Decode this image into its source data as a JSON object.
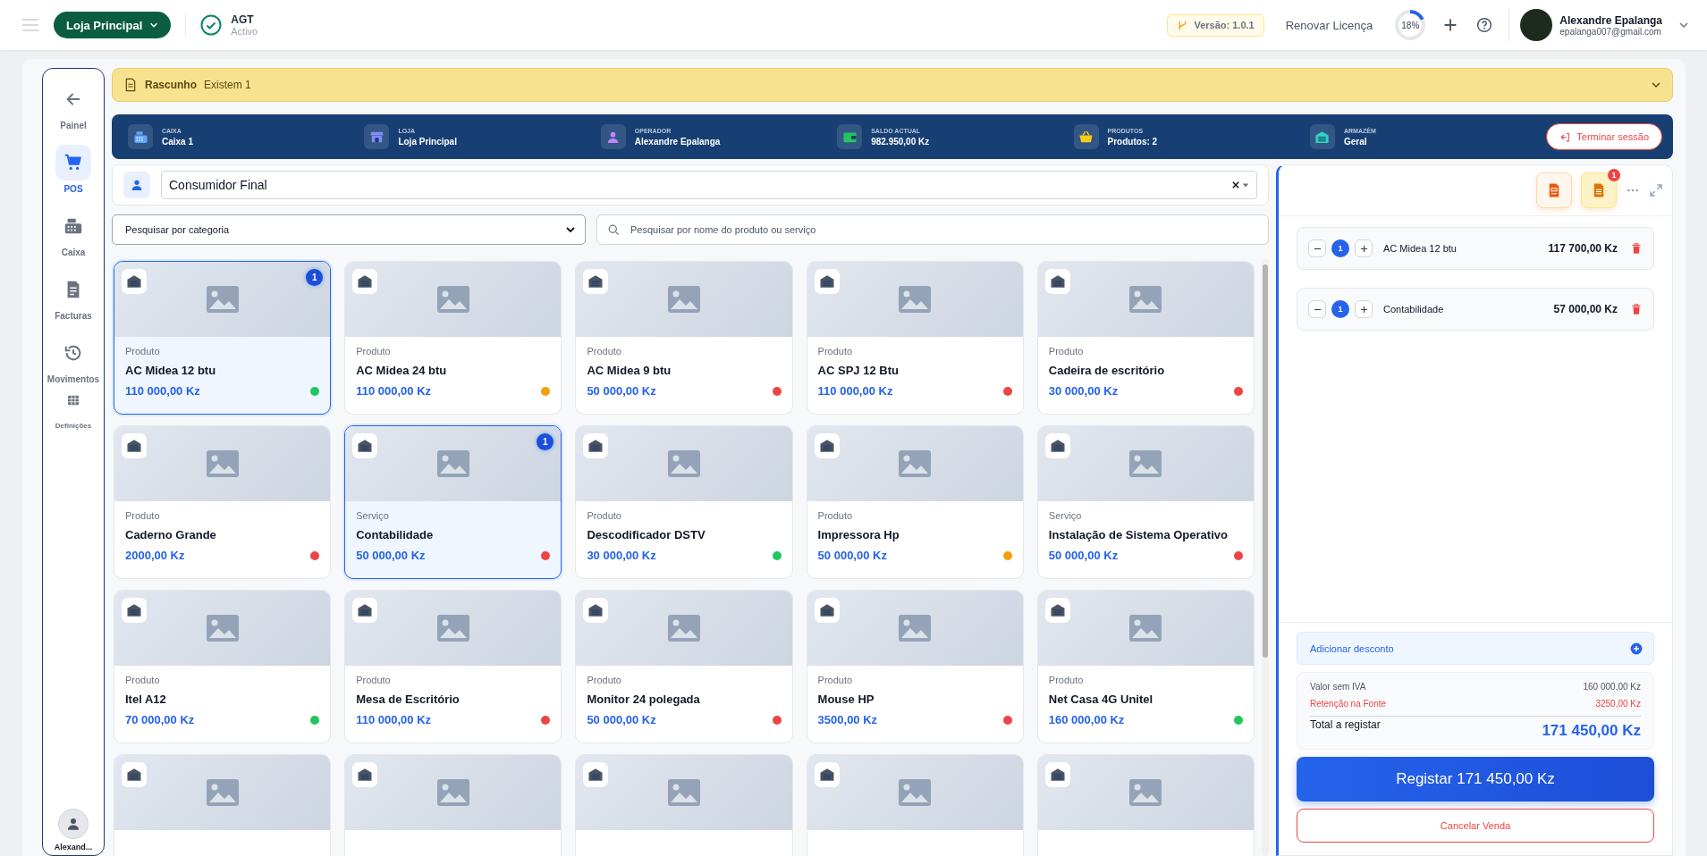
{
  "topbar": {
    "store_button": "Loja Principal",
    "agt": {
      "title": "AGT",
      "status": "Activo"
    },
    "version": "Versão: 1.0.1",
    "renew": "Renovar Licença",
    "progress": {
      "label": "18%",
      "level": 0.18
    },
    "user": {
      "name": "Alexandre Epalanga",
      "email": "epalanga007@gmail.com"
    }
  },
  "sidebar": {
    "items": [
      {
        "label": "Painel",
        "kind": "back",
        "selected": false
      },
      {
        "label": "POS",
        "kind": "cart",
        "selected": true
      },
      {
        "label": "Caixa",
        "kind": "register",
        "selected": false
      },
      {
        "label": "Facturas",
        "kind": "invoice",
        "selected": false
      },
      {
        "label": "Movimentos",
        "kind": "history",
        "selected": false
      },
      {
        "label": "Definições",
        "kind": "grid",
        "selected": false
      }
    ],
    "user_label": "Alexand..."
  },
  "draft": {
    "title": "Rascunho",
    "text": "Existem 1"
  },
  "session": {
    "items": [
      {
        "label": "CAIXA",
        "value": "Caixa 1",
        "kind": "register",
        "color": "#60a5fa"
      },
      {
        "label": "LOJA",
        "value": "Loja Principal",
        "kind": "store",
        "color": "#818cf8"
      },
      {
        "label": "OPERADOR",
        "value": "Alexandre Epalanga",
        "kind": "person",
        "color": "#c084fc"
      },
      {
        "label": "SALDO ACTUAL",
        "value": "982.950,00 Kz",
        "kind": "wallet",
        "color": "#22c55e"
      },
      {
        "label": "PRODUTOS",
        "value": "Produtos: 2",
        "kind": "basket",
        "color": "#facc15"
      },
      {
        "label": "ARMAZÉM",
        "value": "Geral",
        "kind": "warehouse",
        "color": "#2dd4bf"
      }
    ],
    "end_button": "Terminar sessão"
  },
  "customer": {
    "value": "Consumidor Final"
  },
  "category": {
    "placeholder": "Pesquisar por categoria"
  },
  "search": {
    "placeholder": "Pesquisar por nome do produto ou serviço"
  },
  "products": [
    {
      "kind": "item",
      "type": "Produto",
      "name": "AC Midea 12 btu",
      "price": "110 000,00 Kz",
      "color": "#22c55e",
      "selected": true,
      "count": "1"
    },
    {
      "kind": "item",
      "type": "Produto",
      "name": "AC Midea 24 btu",
      "price": "110 000,00 Kz",
      "color": "#f59e0b",
      "selected": false
    },
    {
      "kind": "item",
      "type": "Produto",
      "name": "AC Midea 9 btu",
      "price": "50 000,00 Kz",
      "color": "#ef4444",
      "selected": false
    },
    {
      "kind": "item",
      "type": "Produto",
      "name": "AC SPJ 12 Btu",
      "price": "110 000,00 Kz",
      "color": "#ef4444",
      "selected": false
    },
    {
      "kind": "item",
      "type": "Produto",
      "name": "Cadeira de escritório",
      "price": "30 000,00 Kz",
      "color": "#ef4444",
      "selected": false
    },
    {
      "kind": "item",
      "type": "Produto",
      "name": "Caderno Grande",
      "price": "2000,00 Kz",
      "color": "#ef4444",
      "selected": false
    },
    {
      "kind": "item",
      "type": "Serviço",
      "name": "Contabilidade",
      "price": "50 000,00 Kz",
      "color": "#ef4444",
      "selected": true,
      "count": "1"
    },
    {
      "kind": "item",
      "type": "Produto",
      "name": "Descodificador DSTV",
      "price": "30 000,00 Kz",
      "color": "#22c55e",
      "selected": false
    },
    {
      "kind": "item",
      "type": "Produto",
      "name": "Impressora Hp",
      "price": "50 000,00 Kz",
      "color": "#f59e0b",
      "selected": false
    },
    {
      "kind": "item",
      "type": "Serviço",
      "name": "Instalação de Sistema Operativo",
      "price": "50 000,00 Kz",
      "color": "#ef4444",
      "selected": false
    },
    {
      "kind": "item",
      "type": "Produto",
      "name": "Itel A12",
      "price": "70 000,00 Kz",
      "color": "#22c55e",
      "selected": false
    },
    {
      "kind": "item",
      "type": "Produto",
      "name": "Mesa de Escritório",
      "price": "110 000,00 Kz",
      "color": "#ef4444",
      "selected": false
    },
    {
      "kind": "item",
      "type": "Produto",
      "name": "Monitor 24 polegada",
      "price": "50 000,00 Kz",
      "color": "#ef4444",
      "selected": false
    },
    {
      "kind": "item",
      "type": "Produto",
      "name": "Mouse HP",
      "price": "3500,00 Kz",
      "color": "#ef4444",
      "selected": false
    },
    {
      "kind": "item",
      "type": "Produto",
      "name": "Net Casa 4G Unitel",
      "price": "160 000,00 Kz",
      "color": "#22c55e",
      "selected": false
    },
    {
      "kind": "partial"
    },
    {
      "kind": "partial"
    },
    {
      "kind": "partial"
    },
    {
      "kind": "partial"
    },
    {
      "kind": "partial"
    }
  ],
  "cart": {
    "order_badge": "1",
    "items": [
      {
        "qty": "1",
        "name": "AC Midea 12 btu",
        "price": "117 700,00 Kz"
      },
      {
        "qty": "1",
        "name": "Contabilidade",
        "price": "57 000,00 Kz"
      }
    ],
    "discount": "Adicionar desconto",
    "summary": [
      {
        "kind": "normal",
        "label": "Valor sem IVA",
        "value": "160 000,00 Kz"
      },
      {
        "kind": "withholding",
        "label": "Retenção na Fonte",
        "value": "3250,00 Kz"
      }
    ],
    "total": {
      "label": "Total a registar",
      "value": "171 450,00 Kz"
    },
    "register_button": "Registar 171 450,00 Kz",
    "cancel_button": "Cancelar Venda"
  }
}
